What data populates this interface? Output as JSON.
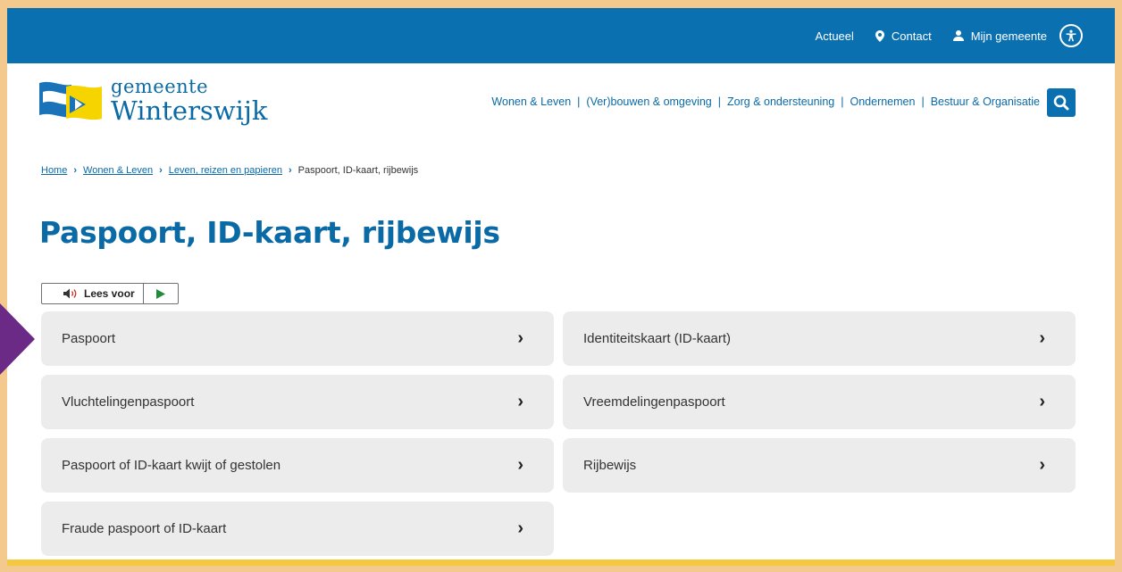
{
  "topbar": {
    "items": [
      {
        "label": "Actueel",
        "icon": ""
      },
      {
        "label": "Contact",
        "icon": "location-pin-icon"
      },
      {
        "label": "Mijn gemeente",
        "icon": "user-icon"
      }
    ],
    "accessibility_icon": "accessibility-icon"
  },
  "logo": {
    "line1": "gemeente",
    "line2": "Winterswijk"
  },
  "nav": {
    "items": [
      "Wonen & Leven",
      "(Ver)bouwen & omgeving",
      "Zorg & ondersteuning",
      "Ondernemen",
      "Bestuur & Organisatie"
    ],
    "separator": "|"
  },
  "breadcrumb": {
    "links": [
      "Home",
      "Wonen & Leven",
      "Leven, reizen en papieren"
    ],
    "current": "Paspoort, ID-kaart, rijbewijs"
  },
  "page": {
    "title": "Paspoort, ID-kaart, rijbewijs"
  },
  "readspeaker": {
    "label": "Lees voor"
  },
  "tiles": [
    "Paspoort",
    "Identiteitskaart (ID-kaart)",
    "Vluchtelingenpaspoort",
    "Vreemdelingenpaspoort",
    "Paspoort of ID-kaart kwijt of gestolen",
    "Rijbewijs",
    "Fraude paspoort of ID-kaart"
  ],
  "colors": {
    "brand_blue": "#0a70b0",
    "text_blue": "#0a6aa6",
    "tile_bg": "#ececec",
    "outer_bg": "#f3c98d",
    "accent_yellow": "#f5c842",
    "marker_purple": "#6b2a86"
  }
}
